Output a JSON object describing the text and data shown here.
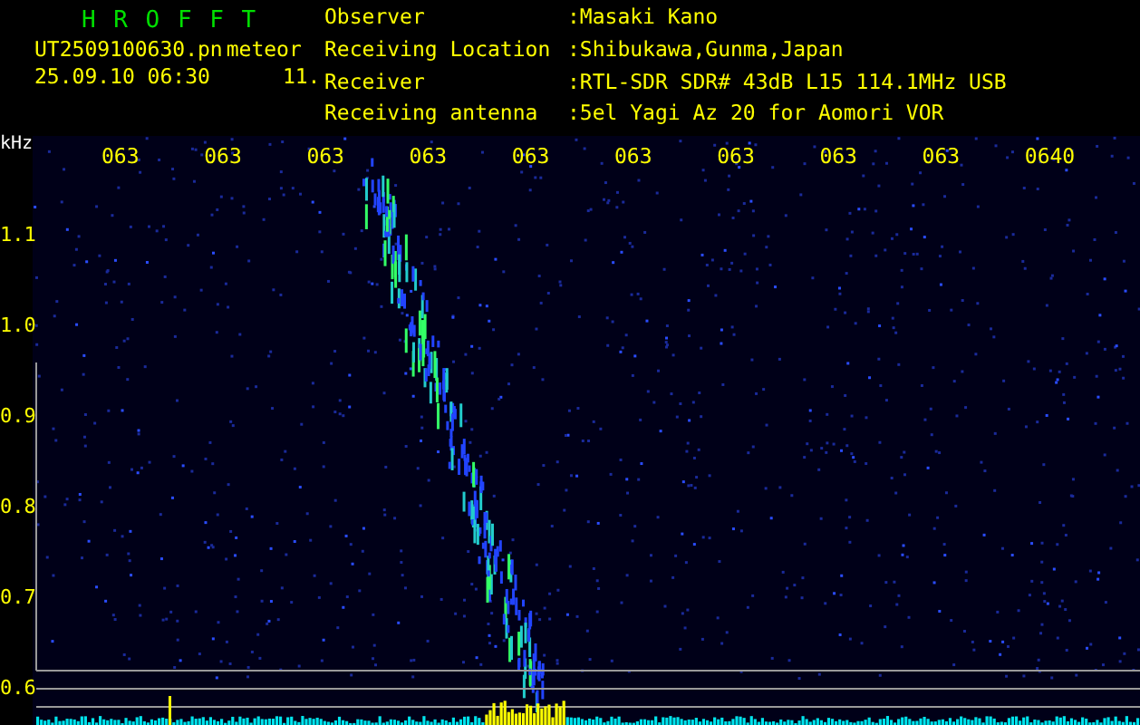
{
  "header": {
    "title": "H R O F F T",
    "file_name": "UT2509100630.pn",
    "tag": "meteor",
    "date_time": "25.09.10 06:30",
    "number": "11."
  },
  "info": [
    {
      "label": "Observer",
      "value": ":Masaki Kano"
    },
    {
      "label": "Receiving Location",
      "value": ":Shibukawa,Gunma,Japan"
    },
    {
      "label": "Receiver",
      "value": ":RTL-SDR SDR# 43dB L15 114.1MHz USB"
    },
    {
      "label": "Receiving antenna",
      "value": ":5el Yagi Az 20 for Aomori VOR"
    }
  ],
  "axis": {
    "unit": "kHz",
    "y_labels": [
      "1.1",
      "1.0",
      "0.9",
      "0.8",
      "0.7",
      "0.6"
    ],
    "time_labels": [
      "063",
      "063",
      "063",
      "063",
      "063",
      "063",
      "063",
      "063",
      "063",
      "0640"
    ]
  }
}
